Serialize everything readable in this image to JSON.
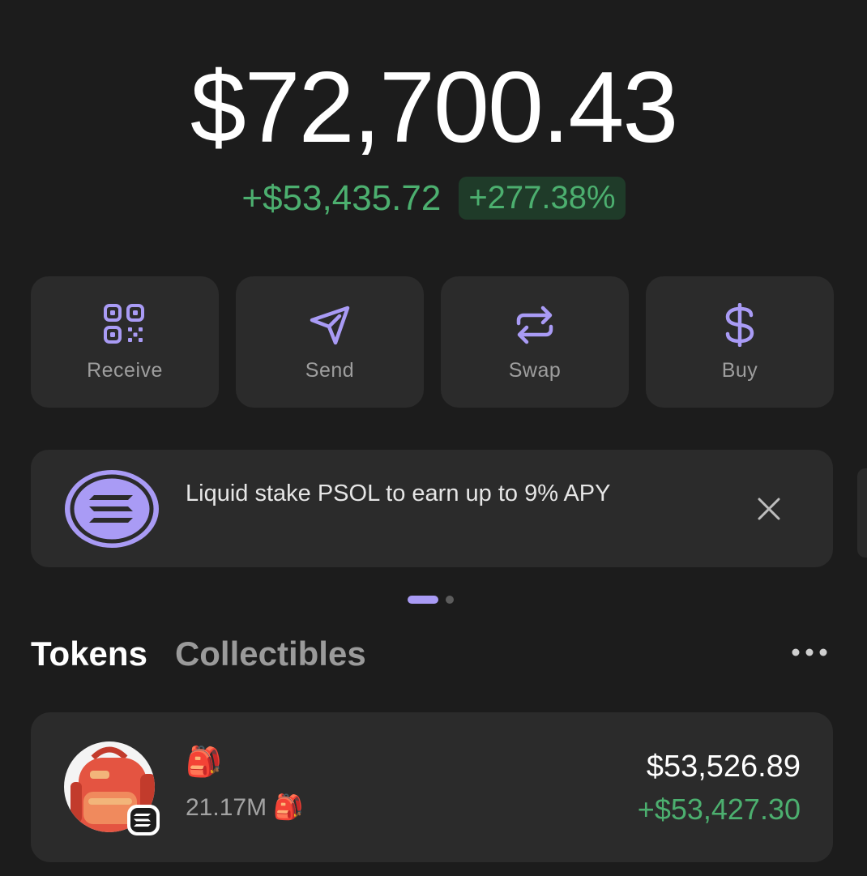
{
  "wallet": {
    "balance": "$72,700.43",
    "change_amount": "+$53,435.72",
    "change_percent": "+277.38%"
  },
  "actions": [
    {
      "label": "Receive",
      "icon": "qr-code-icon"
    },
    {
      "label": "Send",
      "icon": "paper-plane-icon"
    },
    {
      "label": "Swap",
      "icon": "swap-arrows-icon"
    },
    {
      "label": "Buy",
      "icon": "dollar-icon"
    }
  ],
  "promo": {
    "text": "Liquid stake PSOL to earn up to 9% APY",
    "icon": "solana-logo-icon"
  },
  "tabs": [
    {
      "label": "Tokens",
      "active": true
    },
    {
      "label": "Collectibles",
      "active": false
    }
  ],
  "tokens": [
    {
      "symbol": "🎒",
      "amount": "21.17M 🎒",
      "value": "$53,526.89",
      "pnl": "+$53,427.30"
    }
  ],
  "colors": {
    "background": "#1c1c1c",
    "card": "#2b2b2b",
    "accent": "#a99bf5",
    "positive": "#4caf6f"
  }
}
